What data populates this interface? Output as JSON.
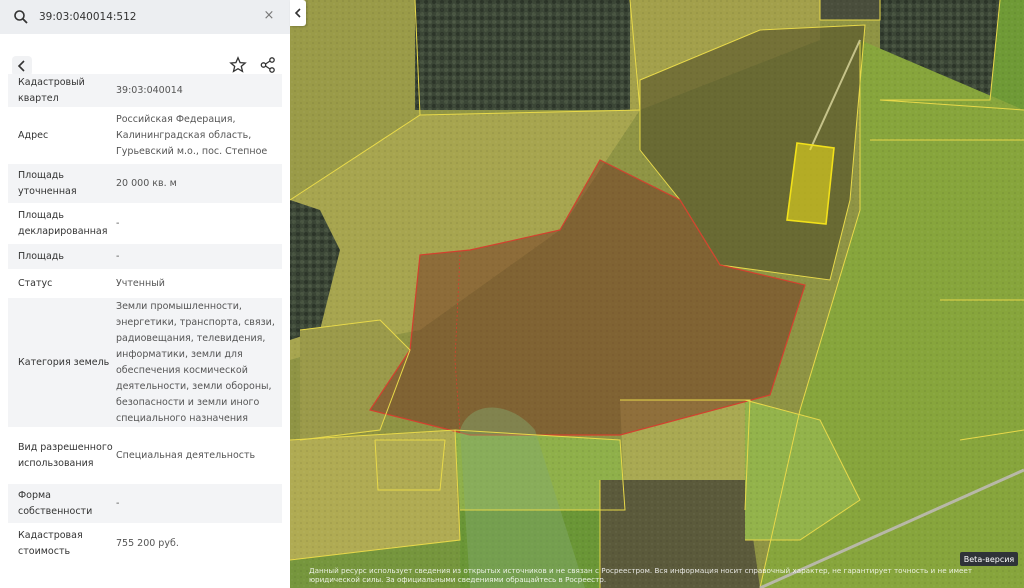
{
  "search": {
    "value": "39:03:040014:512",
    "clear_symbol": "×"
  },
  "toolbar": {
    "back_icon": "chevron-left-icon",
    "favorite_icon": "star-icon",
    "share_icon": "share-icon"
  },
  "collapse_icon": "chevron-left-icon",
  "details": {
    "rows": [
      {
        "key": "Кадастровый квартел",
        "value": "39:03:040014"
      },
      {
        "key": "Адрес",
        "value": "Российская Федерация, Калининградская область, Гурьевский м.о., пос. Степное"
      },
      {
        "key": "Площадь уточненная",
        "value": "20 000 кв. м"
      },
      {
        "key": "Площадь декларированная",
        "value": "-"
      },
      {
        "key": "Площадь",
        "value": "-"
      },
      {
        "key": "Статус",
        "value": "Учтенный"
      },
      {
        "key": "Категория земель",
        "value": "Земли промышленности, энергетики, транспорта, связи, радиовещания, телевидения, информатики, земли для обеспечения космической деятельности, земли обороны, безопасности и земли иного специального назначения"
      },
      {
        "key": "Вид разрешенного использования",
        "value": "Специальная деятельность"
      },
      {
        "key": "Форма собственности",
        "value": "-"
      },
      {
        "key": "Кадастровая стоимость",
        "value": "755 200 руб."
      }
    ]
  },
  "footer": {
    "disclaimer": "Данный ресурс использует сведения из открытых источников и не связан с Росреестром. Вся информация носит справочный характер, не гарантирует точность и не имеет юридической силы. За официальными сведениями обращайтесь в Росреестр.",
    "beta_label": "Beta-версия"
  },
  "colors": {
    "parcel_selected": "#f2e11a",
    "parcel_red": "#c0392b",
    "parcel_border": "#e8d94a",
    "sidebar_bg": "#ffffff",
    "row_alt": "#f3f4f6"
  }
}
